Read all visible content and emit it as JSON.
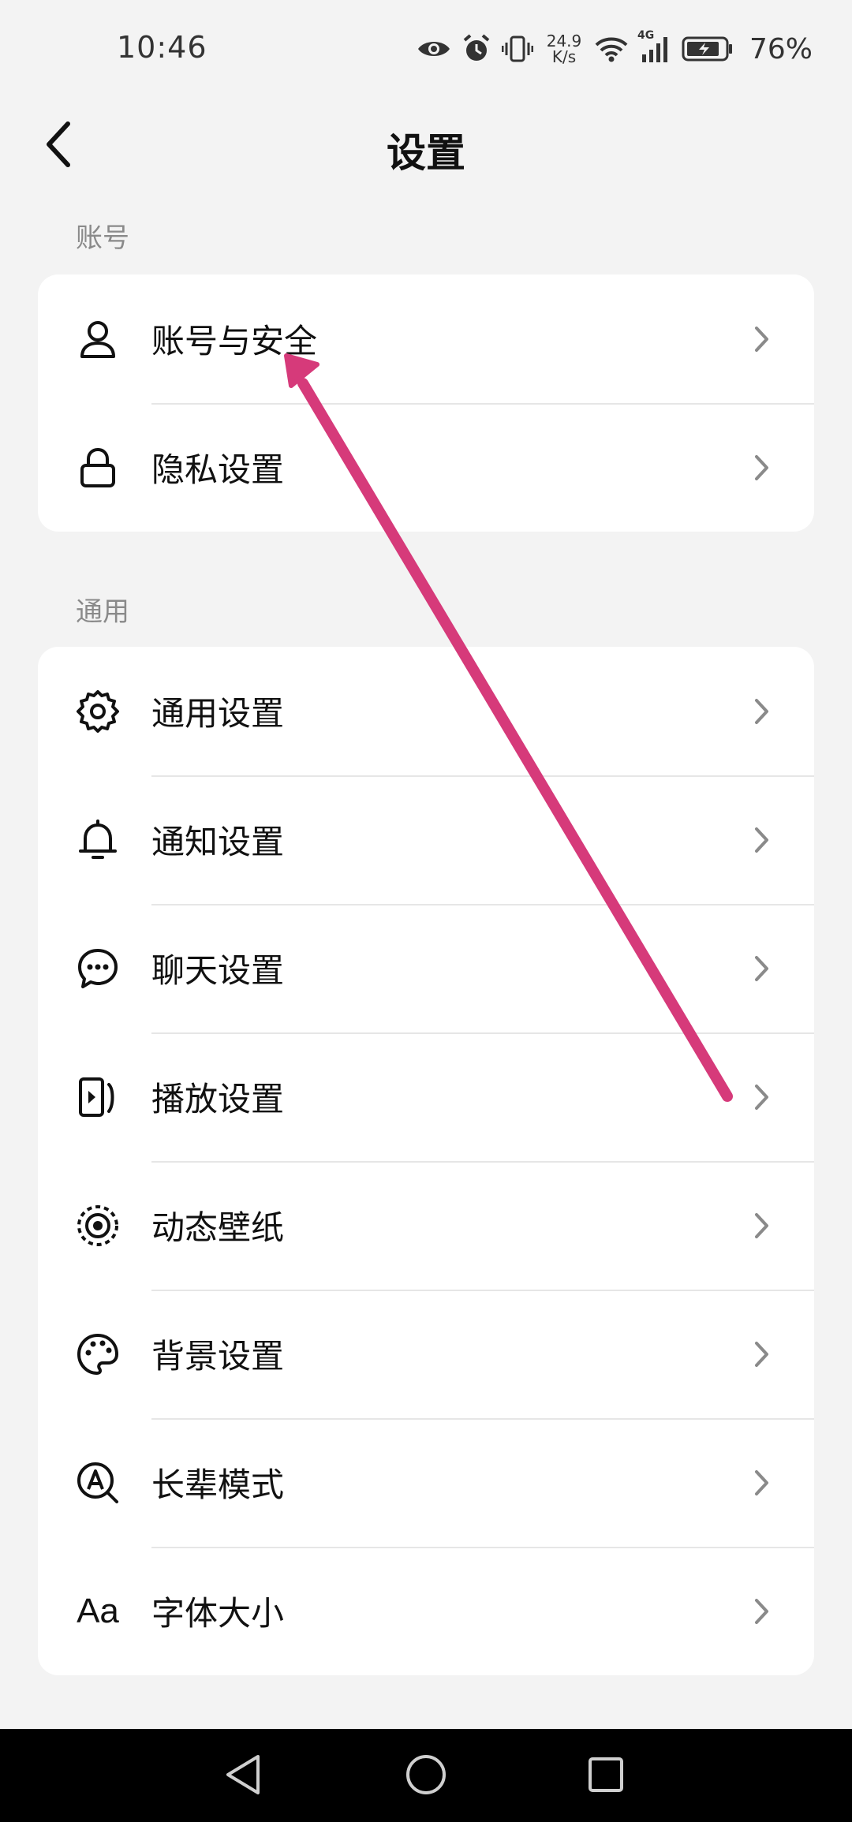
{
  "status_bar": {
    "time": "10:46",
    "net_speed_value": "24.9",
    "net_speed_unit": "K/s",
    "network_type": "4G",
    "battery": "76%"
  },
  "header": {
    "title": "设置",
    "back_icon": "chevron-left-icon"
  },
  "sections": [
    {
      "label": "账号",
      "items": [
        {
          "label": "账号与安全",
          "icon": "user-icon"
        },
        {
          "label": "隐私设置",
          "icon": "lock-icon"
        }
      ]
    },
    {
      "label": "通用",
      "items": [
        {
          "label": "通用设置",
          "icon": "gear-icon"
        },
        {
          "label": "通知设置",
          "icon": "bell-icon"
        },
        {
          "label": "聊天设置",
          "icon": "chat-bubble-icon"
        },
        {
          "label": "播放设置",
          "icon": "play-screen-icon"
        },
        {
          "label": "动态壁纸",
          "icon": "live-wallpaper-icon"
        },
        {
          "label": "背景设置",
          "icon": "palette-icon"
        },
        {
          "label": "长辈模式",
          "icon": "elder-mode-icon"
        },
        {
          "label": "字体大小",
          "icon": "font-size-icon",
          "glyph": "Aa"
        }
      ]
    }
  ],
  "annotation": {
    "type": "arrow",
    "color": "#d63a7a"
  },
  "colors": {
    "background": "#f3f3f3",
    "card": "#ffffff",
    "section_label": "#8a8a8a",
    "chevron": "#8a8a8a",
    "arrow": "#d63a7a"
  }
}
